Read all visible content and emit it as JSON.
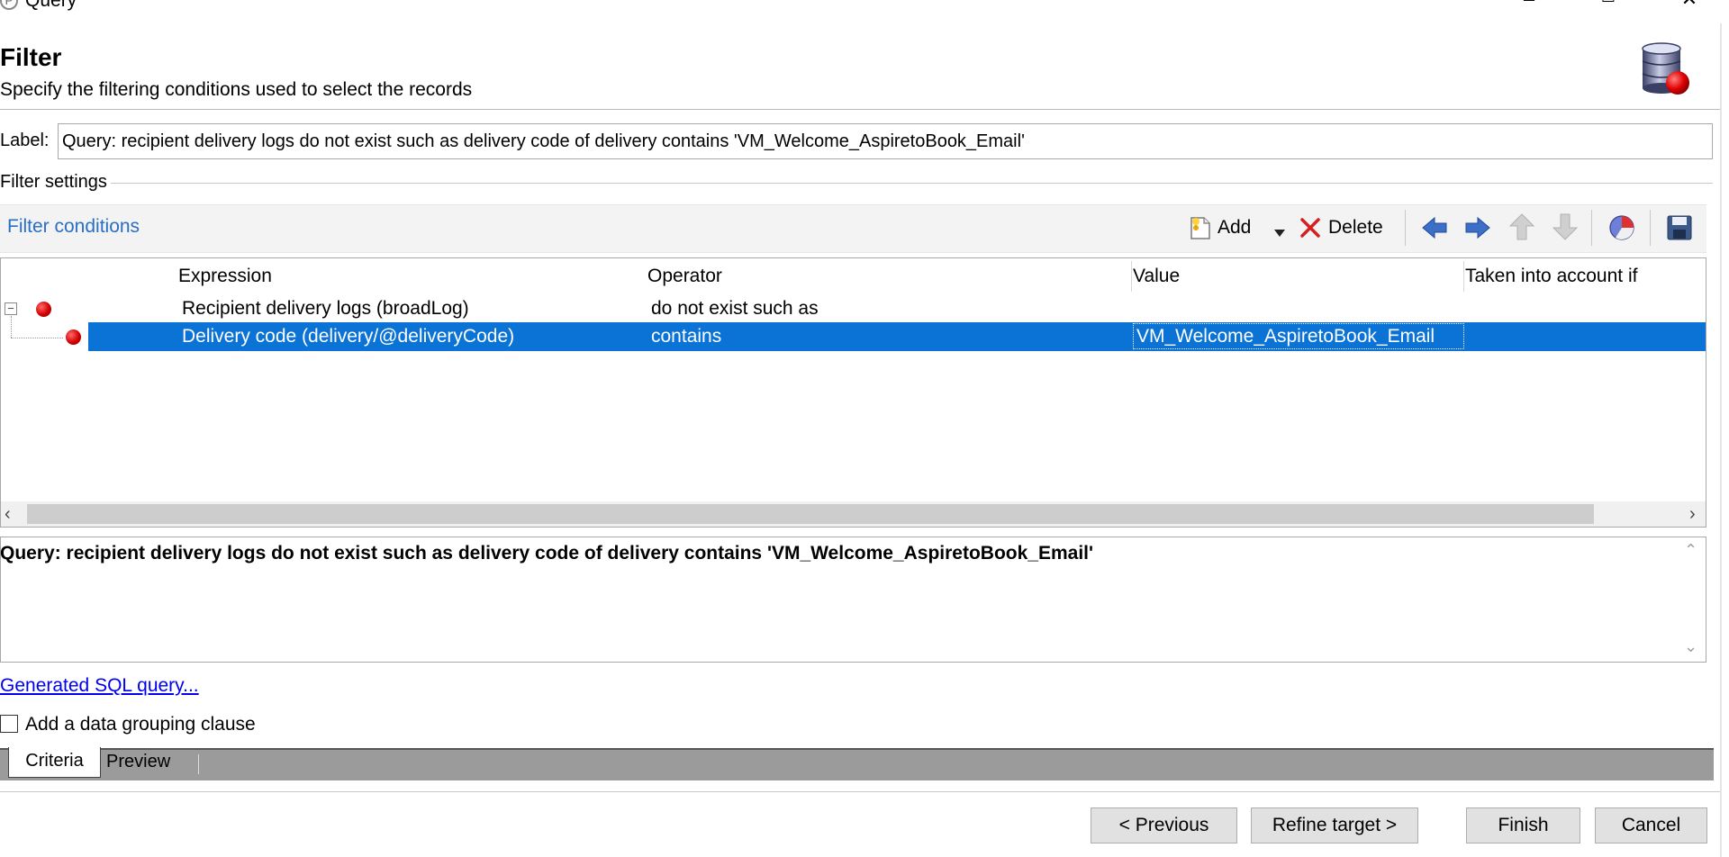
{
  "window": {
    "title": "Query *",
    "minimize": "–",
    "maximize": "☐",
    "close": "✕"
  },
  "header": {
    "title": "Filter",
    "subtitle": "Specify the filtering conditions used to select the records"
  },
  "label": {
    "caption": "Label:",
    "value": "Query: recipient delivery logs do not exist such as delivery code of delivery contains 'VM_Welcome_AspiretoBook_Email'"
  },
  "filter_settings": {
    "legend": "Filter settings",
    "conditions_label": "Filter conditions"
  },
  "toolbar": {
    "add_label": "Add",
    "delete_label": "Delete"
  },
  "grid": {
    "columns": [
      "Expression",
      "Operator",
      "Value",
      "Taken into account if"
    ],
    "rows": [
      {
        "expression": "Recipient delivery logs (broadLog)",
        "operator": "do not exist such as",
        "value": "",
        "condition": ""
      },
      {
        "expression": "Delivery code (delivery/@deliveryCode)",
        "operator": "contains",
        "value": "VM_Welcome_AspiretoBook_Email",
        "condition": ""
      }
    ]
  },
  "description": {
    "text": "Query: recipient delivery logs do not exist such as delivery code of delivery contains 'VM_Welcome_AspiretoBook_Email'"
  },
  "links": {
    "sql": "Generated SQL query..."
  },
  "grouping": {
    "label": "Add a data grouping clause",
    "checked": false
  },
  "tabs": {
    "criteria": "Criteria",
    "preview": "Preview"
  },
  "buttons": {
    "previous": "< Previous",
    "refine": "Refine target >",
    "finish": "Finish",
    "cancel": "Cancel"
  },
  "colors": {
    "selection": "#0b73d6",
    "link": "#0000ee",
    "accent": "#2a6fc4"
  }
}
